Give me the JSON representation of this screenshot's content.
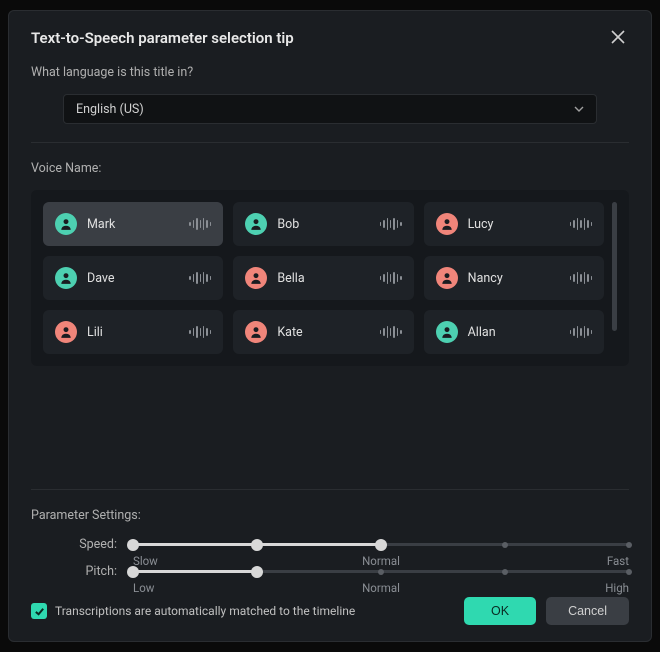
{
  "dialog": {
    "title": "Text-to-Speech parameter selection tip"
  },
  "language": {
    "question": "What language is this title in?",
    "selected": "English (US)"
  },
  "voice": {
    "label": "Voice Name:",
    "items": [
      {
        "name": "Mark",
        "color": "teal",
        "selected": true
      },
      {
        "name": "Bob",
        "color": "teal",
        "selected": false
      },
      {
        "name": "Lucy",
        "color": "pink",
        "selected": false
      },
      {
        "name": "Dave",
        "color": "teal",
        "selected": false
      },
      {
        "name": "Bella",
        "color": "pink",
        "selected": false
      },
      {
        "name": "Nancy",
        "color": "pink",
        "selected": false
      },
      {
        "name": "Lili",
        "color": "pink",
        "selected": false
      },
      {
        "name": "Kate",
        "color": "pink",
        "selected": false
      },
      {
        "name": "Allan",
        "color": "teal",
        "selected": false
      }
    ]
  },
  "params": {
    "label": "Parameter Settings:",
    "speed": {
      "label": "Speed:",
      "ticks": {
        "low": "Slow",
        "mid": "Normal",
        "high": "Fast"
      },
      "value_pct": 50,
      "mid_pct": 50
    },
    "pitch": {
      "label": "Pitch:",
      "ticks": {
        "low": "Low",
        "mid": "Normal",
        "high": "High"
      },
      "value_pct": 25,
      "mid_pct": 50
    }
  },
  "footer": {
    "checkbox_label": "Transcriptions are automatically matched to the timeline",
    "checked": true,
    "ok": "OK",
    "cancel": "Cancel"
  }
}
